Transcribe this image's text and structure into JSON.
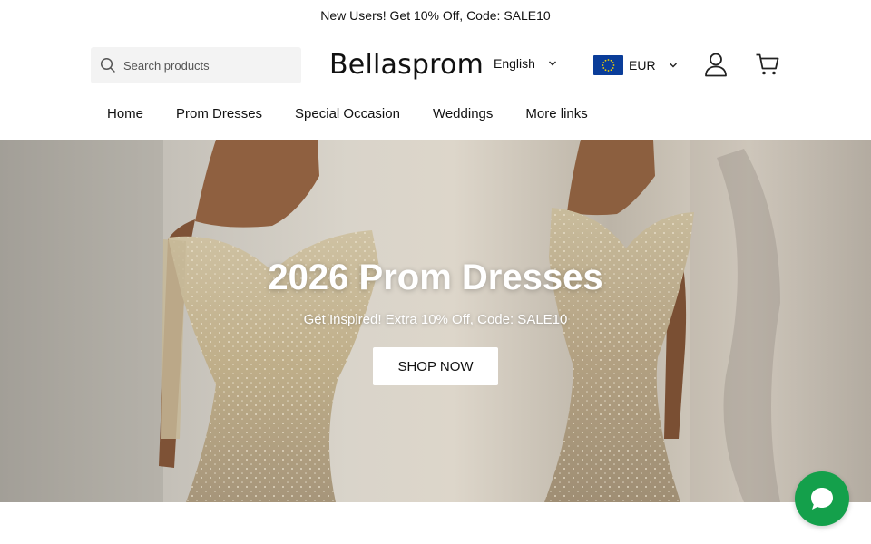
{
  "announcement": {
    "text": "New Users! Get 10% Off, Code: SALE10"
  },
  "header": {
    "search": {
      "placeholder": "Search products",
      "icon": "search-icon"
    },
    "logo": "Bellasprom",
    "language": {
      "selected": "English",
      "icon": "chevron-down-icon"
    },
    "currency": {
      "selected": "EUR",
      "flag": "eu-flag-icon",
      "icon": "chevron-down-icon"
    },
    "icons": {
      "account": "user-icon",
      "cart": "cart-icon"
    }
  },
  "nav": {
    "items": [
      {
        "label": "Home"
      },
      {
        "label": "Prom Dresses"
      },
      {
        "label": "Special Occasion"
      },
      {
        "label": "Weddings"
      },
      {
        "label": "More links"
      }
    ]
  },
  "hero": {
    "title": "2026 Prom Dresses",
    "subtitle": "Get Inspired! Extra 10% Off, Code: SALE10",
    "button_label": "SHOP NOW"
  },
  "chat": {
    "icon": "chat-bubble-icon"
  },
  "colors": {
    "chat_green": "#14a04b",
    "flag_blue": "#0a3d99",
    "flag_star": "#f5d300"
  }
}
